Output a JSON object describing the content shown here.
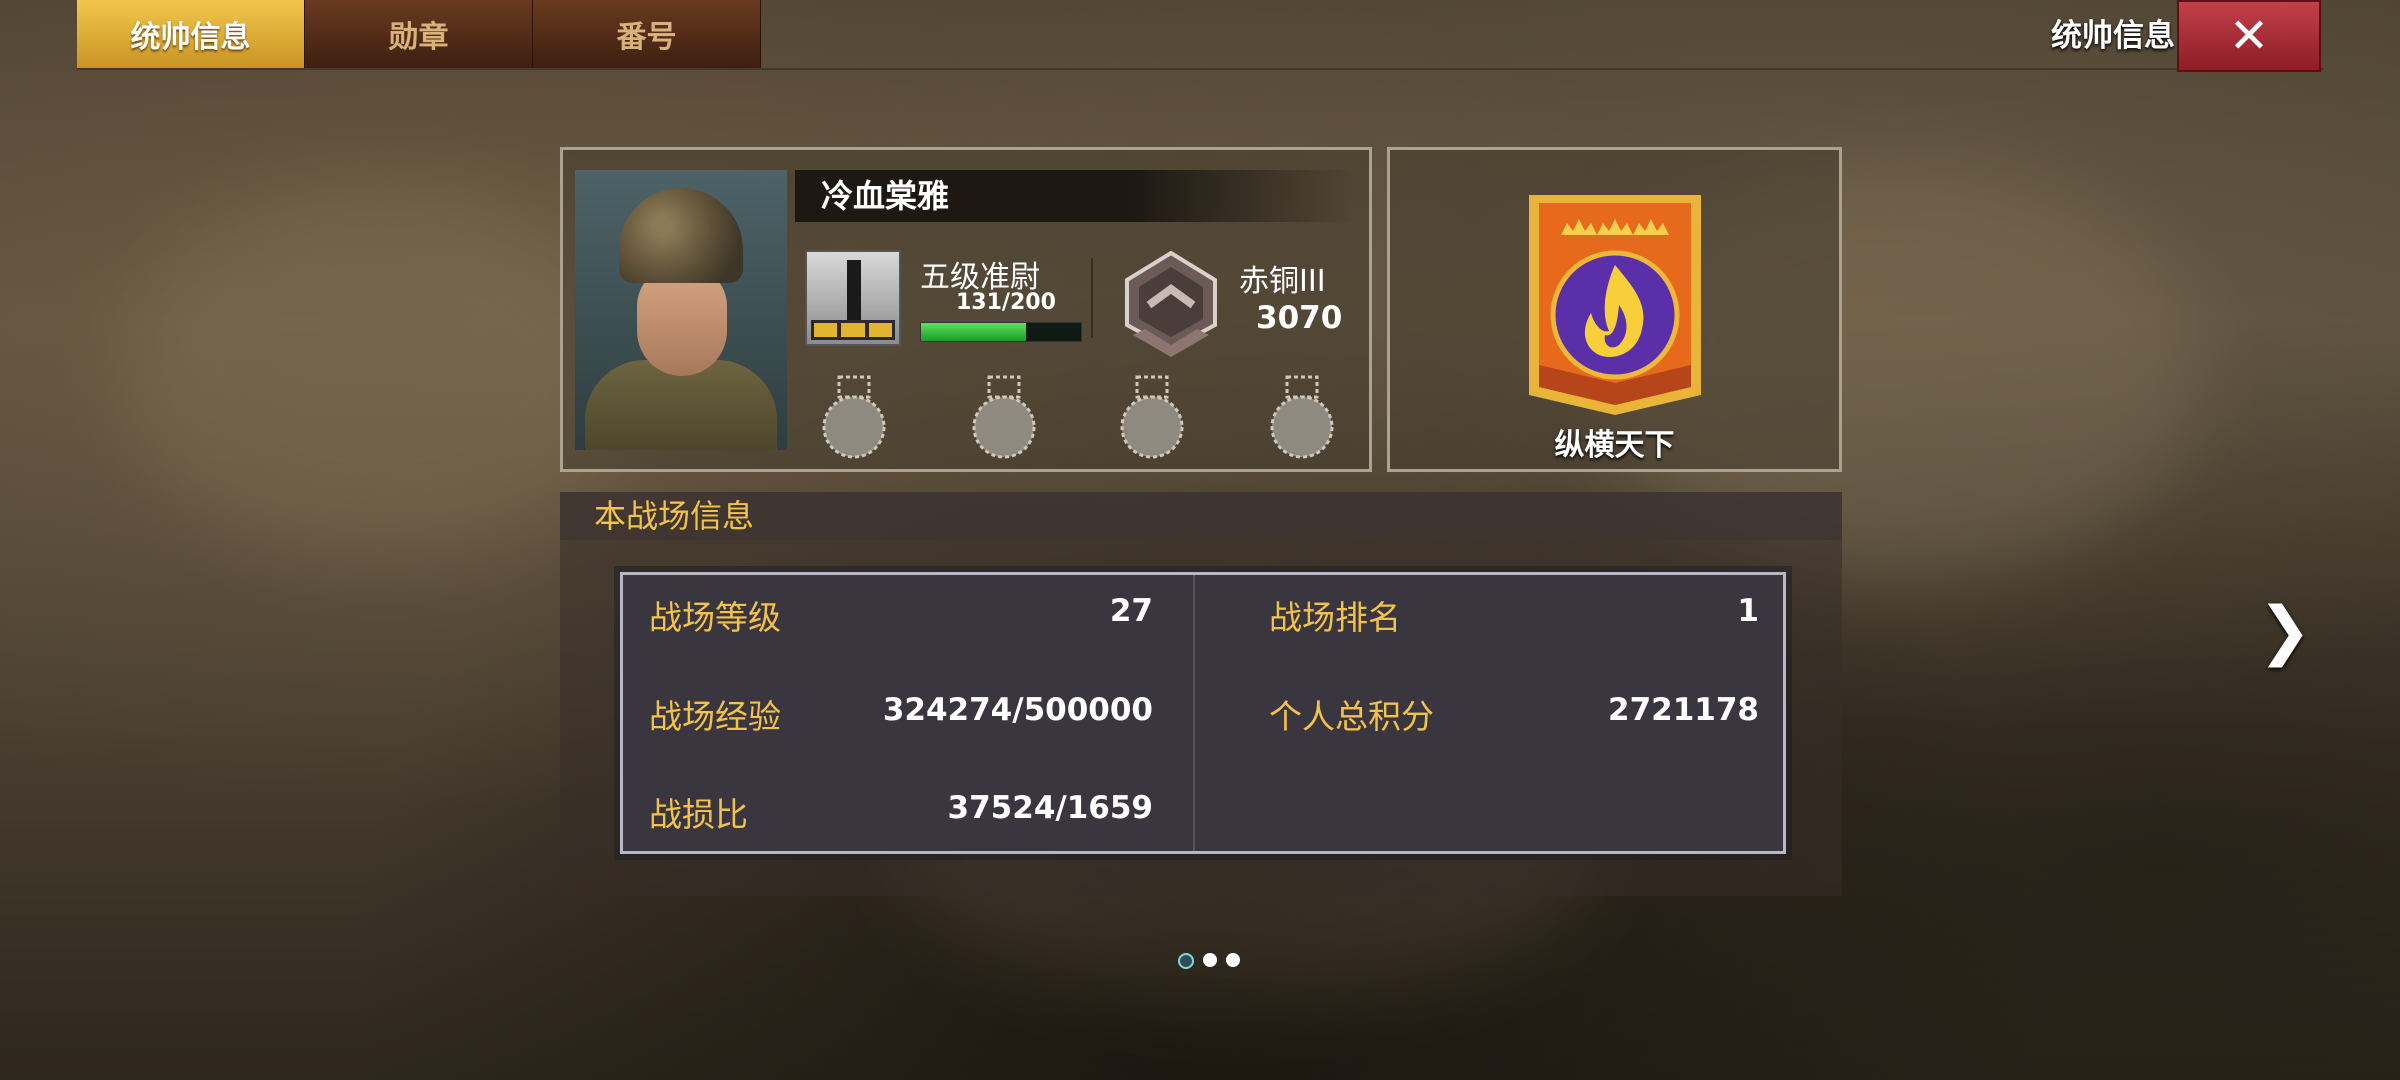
{
  "tabs": [
    {
      "label": "统帅信息",
      "active": true
    },
    {
      "label": "勋章",
      "active": false
    },
    {
      "label": "番号",
      "active": false
    }
  ],
  "header": {
    "title": "统帅信息",
    "close_icon": "close-icon"
  },
  "profile": {
    "name": "冷血棠雅",
    "portrait_icon": "soldier-portrait",
    "rank": {
      "name": "五级准尉",
      "exp_text": "131/200",
      "exp_progress": 0.655,
      "icon": "rank-insignia-icon"
    },
    "league": {
      "name": "赤铜III",
      "score": "3070",
      "icon": "bronze-league-icon"
    },
    "medal_slots": 4
  },
  "title_badge": {
    "name": "纵横天下",
    "icon": "fire-crown-emblem-icon"
  },
  "battlefield": {
    "header": "本战场信息",
    "left": [
      {
        "label": "战场等级",
        "value": "27"
      },
      {
        "label": "战场经验",
        "value": "324274/500000"
      },
      {
        "label": "战损比",
        "value": "37524/1659"
      }
    ],
    "right": [
      {
        "label": "战场排名",
        "value": "1"
      },
      {
        "label": "个人总积分",
        "value": "2721178"
      }
    ]
  },
  "navigation": {
    "next_icon": "chevron-right-icon"
  },
  "pager": {
    "count": 3,
    "active": 0
  },
  "colors": {
    "accent_gold": "#f3c24a",
    "tab_active": "#e0b03a",
    "close_red": "#b3333c"
  }
}
